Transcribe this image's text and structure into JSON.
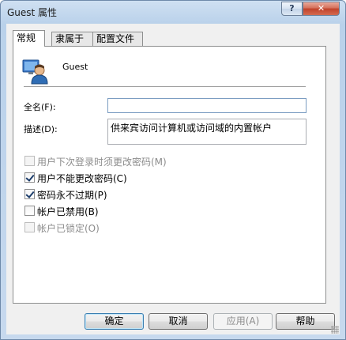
{
  "window": {
    "title": "Guest 属性",
    "help_label": "?",
    "close_label": "✕"
  },
  "tabs": [
    {
      "label": "常规",
      "active": true
    },
    {
      "label": "隶属于",
      "active": false
    },
    {
      "label": "配置文件",
      "active": false
    }
  ],
  "user": {
    "name": "Guest",
    "icon": "user-icon"
  },
  "fields": {
    "full_name_label": "全名(F):",
    "full_name_value": "",
    "description_label": "描述(D):",
    "description_value": "供来宾访问计算机或访问域的内置帐户"
  },
  "checkboxes": [
    {
      "label": "用户下次登录时须更改密码(M)",
      "checked": false,
      "enabled": false
    },
    {
      "label": "用户不能更改密码(C)",
      "checked": true,
      "enabled": true
    },
    {
      "label": "密码永不过期(P)",
      "checked": true,
      "enabled": true
    },
    {
      "label": "帐户已禁用(B)",
      "checked": false,
      "enabled": true
    },
    {
      "label": "帐户已锁定(O)",
      "checked": false,
      "enabled": false
    }
  ],
  "buttons": {
    "ok": "确定",
    "cancel": "取消",
    "apply": "应用(A)",
    "help": "帮助"
  },
  "colors": {
    "title_bar": "#b9d1ea",
    "close": "#c1412a",
    "default_border": "#3c7fb1"
  }
}
